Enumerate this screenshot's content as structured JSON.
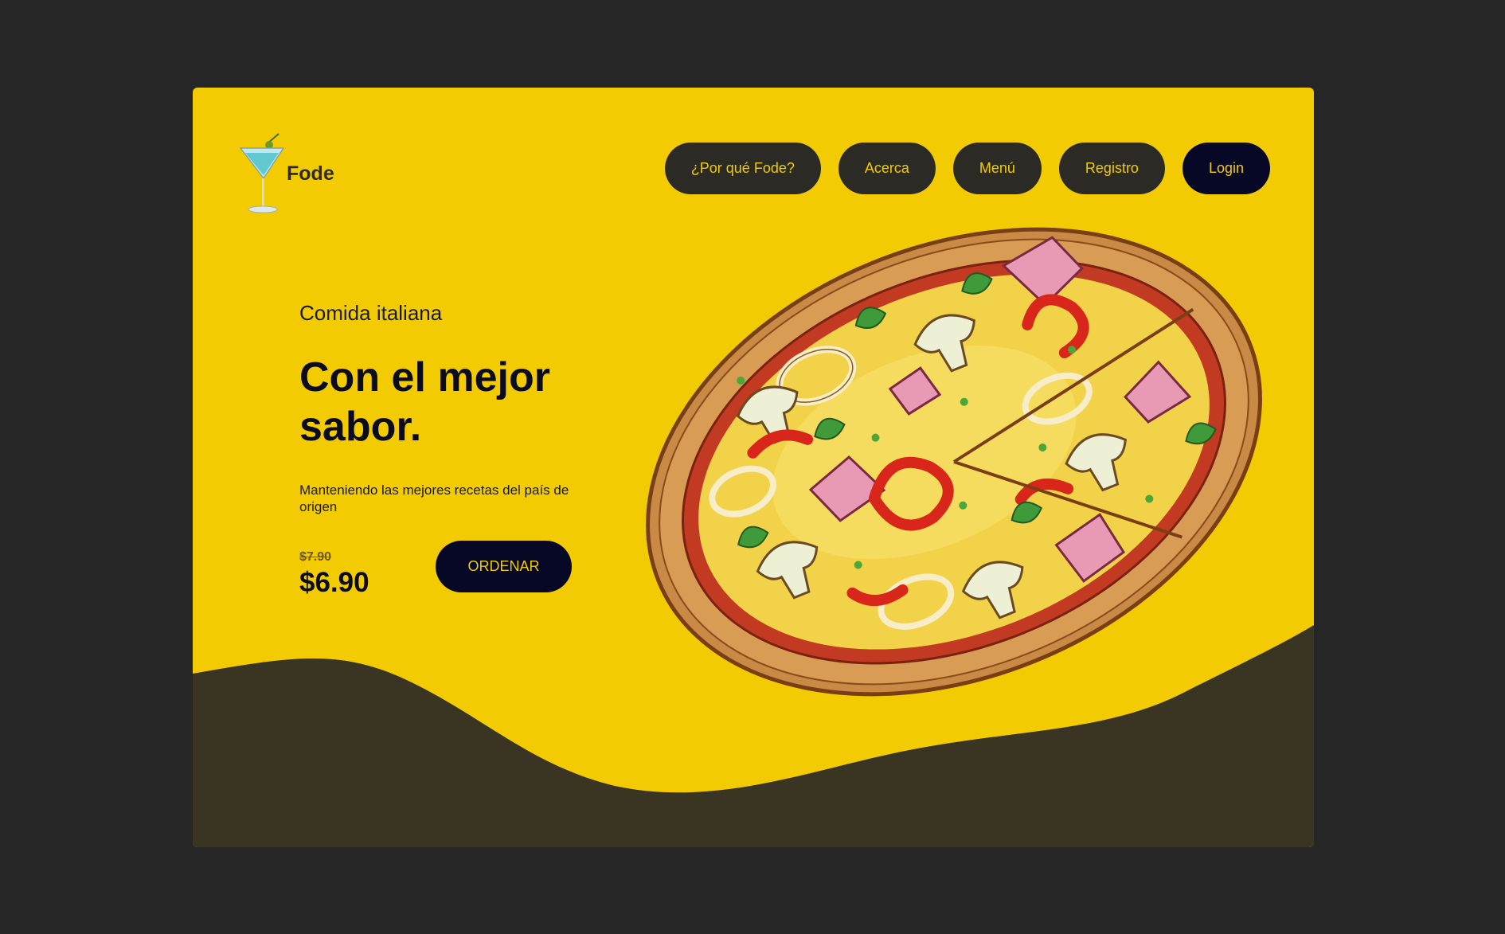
{
  "brand": {
    "name": "Fode",
    "logo_icon": "martini-glass-icon"
  },
  "nav": {
    "items": [
      {
        "label": "¿Por qué Fode?"
      },
      {
        "label": "Acerca"
      },
      {
        "label": "Menú"
      },
      {
        "label": "Registro"
      },
      {
        "label": "Login"
      }
    ]
  },
  "hero": {
    "subtitle": "Comida italiana",
    "headline": "Con el mejor sabor.",
    "description": "Manteniendo las mejores recetas del país de origen",
    "old_price": "$7.90",
    "price": "$6.90",
    "order_label": "ORDENAR",
    "image": "pizza-illustration"
  },
  "colors": {
    "page_background": "#262626",
    "card_background": "#f2cb03",
    "wave": "#3a3422",
    "button_dark": "#2b2a24",
    "button_accent": "#070726",
    "button_text": "#f2cb03"
  }
}
